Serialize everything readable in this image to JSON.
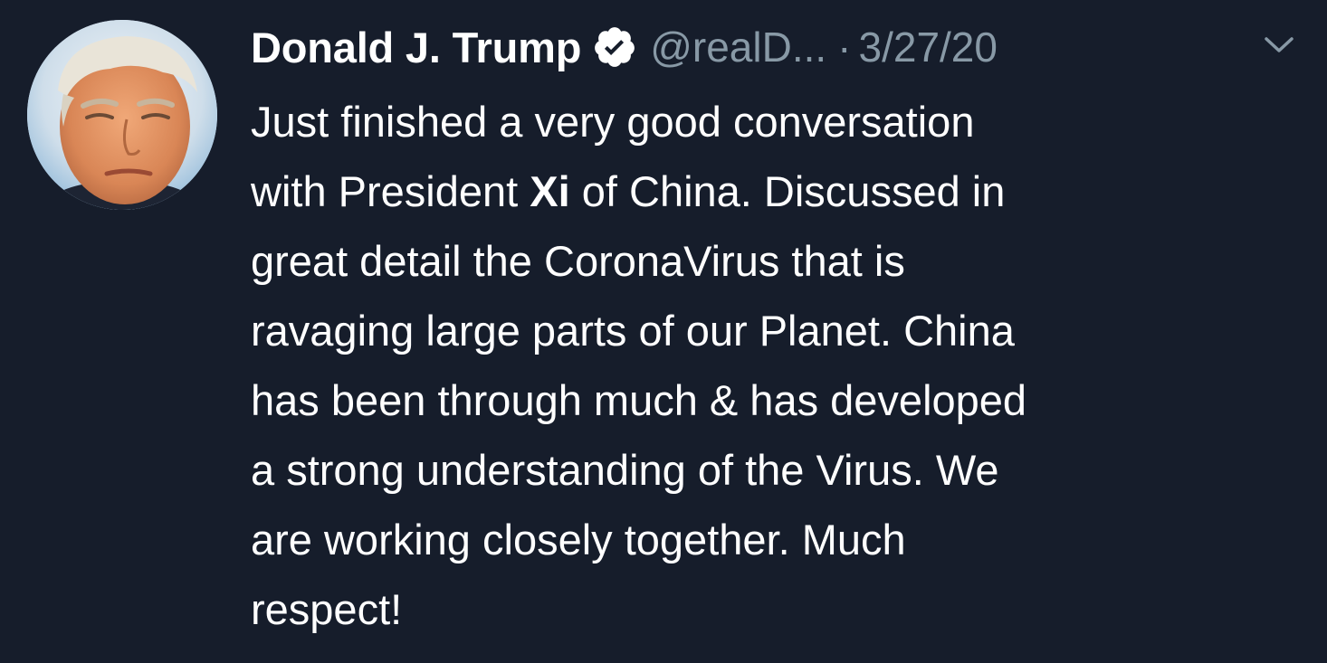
{
  "tweet": {
    "display_name": "Donald J. Trump",
    "handle": "@realD...",
    "separator": "·",
    "date": "3/27/20",
    "icons": {
      "verified": "verified-badge-icon",
      "caret": "chevron-down-icon"
    },
    "text_lines": [
      {
        "before": "Just finished a very good conversation",
        "bold": "",
        "after": ""
      },
      {
        "before": "with President ",
        "bold": "Xi",
        "after": " of China. Discussed in"
      },
      {
        "before": "great detail the CoronaVirus that is",
        "bold": "",
        "after": ""
      },
      {
        "before": "ravaging large parts of our Planet. China",
        "bold": "",
        "after": ""
      },
      {
        "before": "has been through much & has developed",
        "bold": "",
        "after": ""
      },
      {
        "before": "a strong understanding of the Virus. We",
        "bold": "",
        "after": ""
      },
      {
        "before": "are working closely together. Much",
        "bold": "",
        "after": ""
      },
      {
        "before": "respect!",
        "bold": "",
        "after": ""
      }
    ]
  },
  "colors": {
    "background": "#161d2b",
    "text": "#ffffff",
    "secondary": "#8899a6"
  }
}
